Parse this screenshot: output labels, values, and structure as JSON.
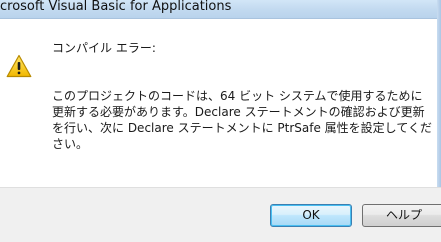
{
  "window": {
    "title": "crosoft Visual Basic for Applications"
  },
  "dialog": {
    "icon": "warning-icon",
    "heading": "コンパイル エラー:",
    "message": "このプロジェクトのコードは、64 ビット システムで使用するために更新する必要があります。Declare ステートメントの確認および更新を行い、次に Declare ステートメントに PtrSafe 属性を設定してください。"
  },
  "buttons": {
    "ok_label": "OK",
    "help_label": "ヘルプ"
  },
  "colors": {
    "warning_fill": "#f5c400",
    "warning_stroke": "#b88a00",
    "ok_border": "#3c7fb1"
  }
}
